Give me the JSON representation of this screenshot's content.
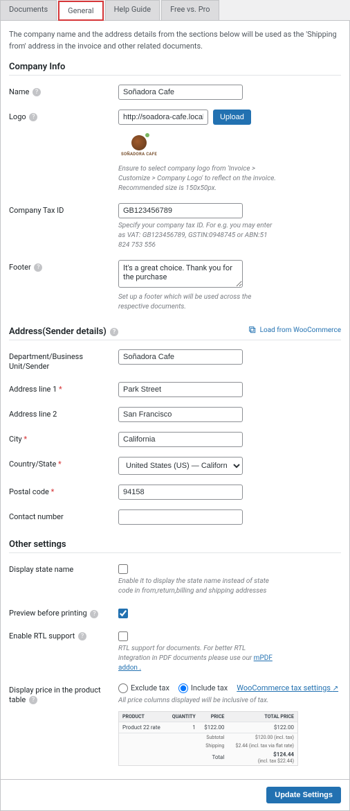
{
  "tabs": {
    "documents": "Documents",
    "general": "General",
    "help": "Help Guide",
    "freevspro": "Free vs. Pro"
  },
  "intro": "The company name and the address details from the sections below will be used as the 'Shipping from' address in the invoice and other related documents.",
  "sections": {
    "company": "Company Info",
    "address": "Address(Sender details)",
    "other": "Other settings"
  },
  "load_from_wc": "Load from WooCommerce",
  "labels": {
    "name": "Name",
    "logo": "Logo",
    "taxid": "Company Tax ID",
    "footer": "Footer",
    "dept": "Department/Business Unit/Sender",
    "addr1": "Address line 1",
    "addr2": "Address line 2",
    "city": "City",
    "country": "Country/State",
    "postal": "Postal code",
    "contact": "Contact number",
    "displaystate": "Display state name",
    "preview": "Preview before printing",
    "rtl": "Enable RTL support",
    "pricedisplay": "Display price in the product table"
  },
  "values": {
    "name": "Soñadora Cafe",
    "logo_url": "http://soadora-cafe.local/wp",
    "logo_brand": "SOÑADORA CAFE",
    "taxid": "GB123456789",
    "footer": "It's a great choice. Thank you for the purchase",
    "dept": "Soñadora Cafe",
    "addr1": "Park Street",
    "addr2": "San Francisco",
    "city": "California",
    "country": "United States (US) — California",
    "postal": "94158",
    "contact": ""
  },
  "upload_btn": "Upload",
  "hints": {
    "logo": "Ensure to select company logo from 'Invoice > Customize > Company Logo' to reflect on the invoice. Recommended size is 150x50px.",
    "taxid": "Specify your company tax ID. For e.g. you may enter as VAT: GB123456789, GSTIN:0948745 or ABN:51 824 753 556",
    "footer": "Set up a footer which will be used across the respective documents.",
    "displaystate": "Enable it to display the state name instead of state code in from,return,billing and shipping addresses",
    "rtl_pre": "RTL support for documents. For better RTL integration in PDF documents please use our ",
    "rtl_link": "mPDF addon .",
    "price": "All price columns displayed will be inclusive of tax."
  },
  "radios": {
    "exclude": "Exclude tax",
    "include": "Include tax",
    "wc_link": "WooCommerce tax settings"
  },
  "preview": {
    "cols": {
      "product": "PRODUCT",
      "qty": "QUANTITY",
      "price": "PRICE",
      "total": "TOTAL PRICE"
    },
    "row": {
      "name": "Product 22 rate",
      "qty": "1",
      "price": "$122.00",
      "total": "$122.00"
    },
    "subtotal_lbl": "Subtotal",
    "subtotal_val": "$120.00 (incl. tax)",
    "shipping_lbl": "Shipping",
    "shipping_val": "$2.44 (incl. tax via flat rate)",
    "total_lbl": "Total",
    "total_val": "$124.44",
    "total_sub": "(incl. tax $22.44)"
  },
  "update": "Update Settings"
}
